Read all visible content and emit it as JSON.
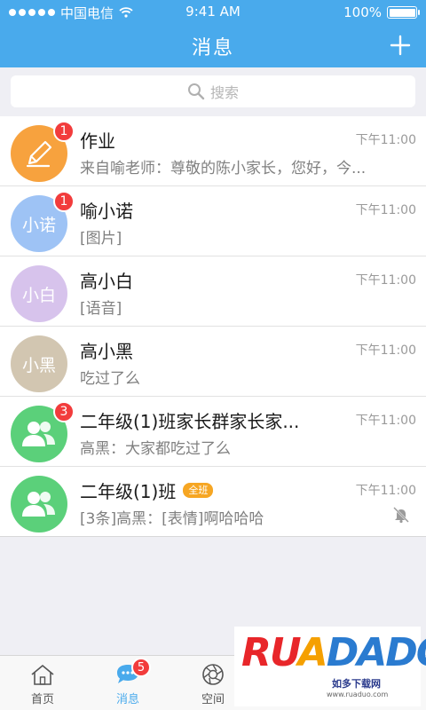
{
  "status_bar": {
    "carrier": "中国电信",
    "time": "9:41 AM",
    "battery": "100%",
    "battery_level": 1.0
  },
  "nav": {
    "title": "消息",
    "add_icon": "plus-icon"
  },
  "search": {
    "placeholder": "搜索",
    "icon": "search-icon"
  },
  "conversations": [
    {
      "name": "作业",
      "preview": "来自喻老师：尊敬的陈小家长，您好，今...",
      "time": "下午11:00",
      "badge": "1",
      "avatar_text": "",
      "avatar_color": "#f7a23e",
      "avatar_icon": "pencil-icon"
    },
    {
      "name": "喻小诺",
      "preview": "[图片]",
      "time": "下午11:00",
      "badge": "1",
      "avatar_text": "小诺",
      "avatar_color": "#9ec3f5"
    },
    {
      "name": "高小白",
      "preview": "[语音]",
      "time": "下午11:00",
      "badge": "",
      "avatar_text": "小白",
      "avatar_color": "#d7c3ec"
    },
    {
      "name": "高小黑",
      "preview": "吃过了么",
      "time": "下午11:00",
      "badge": "",
      "avatar_text": "小黑",
      "avatar_color": "#d2c6b1"
    },
    {
      "name": "二年级(1)班家长群家长家...",
      "preview": "高黑：大家都吃过了么",
      "time": "下午11:00",
      "badge": "3",
      "avatar_text": "",
      "avatar_color": "#5bd07a",
      "avatar_icon": "group-icon"
    },
    {
      "name": "二年级(1)班",
      "tag": "全班",
      "preview": "[3条]高黑：[表情]啊哈哈哈",
      "time": "下午11:00",
      "badge": "",
      "avatar_text": "",
      "avatar_color": "#5bd07a",
      "avatar_icon": "group-icon",
      "muted": true
    }
  ],
  "tabbar": {
    "tabs": [
      {
        "label": "首页",
        "icon": "home-icon",
        "active": false
      },
      {
        "label": "消息",
        "icon": "chat-icon",
        "active": true,
        "badge": "5"
      },
      {
        "label": "空间",
        "icon": "aperture-icon",
        "active": false
      }
    ]
  },
  "watermark": {
    "logo": "RUANDADO",
    "site": "如多下载网",
    "url": "www.ruaduo.com"
  },
  "colors": {
    "primary": "#49aaec",
    "badge": "#f23c3c",
    "tag": "#f6a623"
  }
}
